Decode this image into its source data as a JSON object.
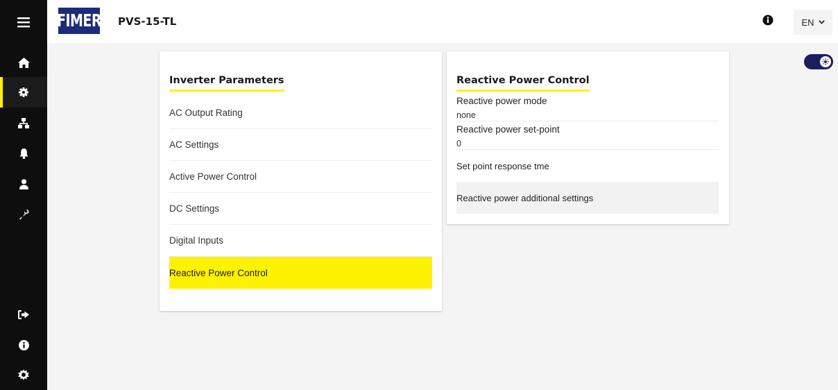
{
  "app": {
    "logo_text": "FIMER",
    "device_name": "PVS-15-TL",
    "language": "EN"
  },
  "sidebar": {
    "items": [
      {
        "name": "home",
        "icon": "home-icon"
      },
      {
        "name": "settings",
        "icon": "gear-icon",
        "active": true
      },
      {
        "name": "network",
        "icon": "network-icon"
      },
      {
        "name": "notifications",
        "icon": "bell-icon"
      },
      {
        "name": "user",
        "icon": "user-icon"
      },
      {
        "name": "tools",
        "icon": "wrench-icon"
      },
      {
        "name": "logout",
        "icon": "logout-icon"
      },
      {
        "name": "info",
        "icon": "info-icon"
      },
      {
        "name": "theme",
        "icon": "sun-icon"
      }
    ]
  },
  "theme_toggle": {
    "on": true
  },
  "inverter_parameters": {
    "title": "Inverter Parameters",
    "items": [
      {
        "label": "AC Output Rating"
      },
      {
        "label": "AC Settings"
      },
      {
        "label": "Active Power Control"
      },
      {
        "label": "DC Settings"
      },
      {
        "label": "Digital Inputs"
      },
      {
        "label": "Reactive Power Control",
        "selected": true
      }
    ]
  },
  "reactive_power_control": {
    "title": "Reactive Power Control",
    "params": [
      {
        "label": "Reactive power mode",
        "value": "none"
      },
      {
        "label": "Reactive power set-point",
        "value": "0"
      }
    ],
    "set_point_response": "Set point response tme",
    "additional_settings": "Reactive power additional settings"
  },
  "colors": {
    "accent_yellow": "#fff200",
    "brand_blue": "#1d2c79",
    "sidebar_bg": "#0e0e0e",
    "toggle_bg": "#1a1f5e"
  }
}
